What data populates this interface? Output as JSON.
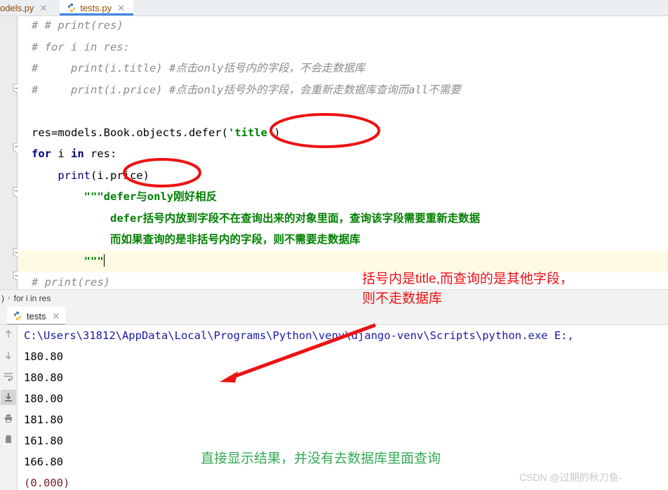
{
  "editor_tabs": [
    {
      "name": "odels.py",
      "icon": "python-file-icon",
      "active": false,
      "close": "✕"
    },
    {
      "name": "tests.py",
      "icon": "python-file-icon",
      "active": true,
      "close": "✕"
    }
  ],
  "code_lines": [
    {
      "indent": 0,
      "segments": [
        {
          "cls": "cmt",
          "text": "# # print(res)"
        }
      ]
    },
    {
      "indent": 0,
      "segments": [
        {
          "cls": "cmt",
          "text": "# for i in res:"
        }
      ]
    },
    {
      "indent": 0,
      "segments": [
        {
          "cls": "cmt",
          "text": "#     print(i.title) #点击only括号内的字段，不会走数据库"
        }
      ]
    },
    {
      "indent": 0,
      "segments": [
        {
          "cls": "cmt",
          "text": "#     print(i.price) #点击only括号外的字段，会重新走数据库查询而all不需要"
        }
      ]
    },
    {
      "indent": 0,
      "segments": [
        {
          "cls": "plain",
          "text": ""
        }
      ]
    },
    {
      "indent": 0,
      "segments": [
        {
          "cls": "plain",
          "text": "res"
        },
        {
          "cls": "plain",
          "text": "=models.Book.objects.defer("
        },
        {
          "cls": "str",
          "text": "'title'"
        },
        {
          "cls": "plain",
          "text": ")"
        }
      ]
    },
    {
      "indent": 0,
      "segments": [
        {
          "cls": "kw",
          "text": "for"
        },
        {
          "cls": "plain",
          "text": " i "
        },
        {
          "cls": "kw",
          "text": "in"
        },
        {
          "cls": "plain",
          "text": " res:"
        }
      ]
    },
    {
      "indent": 0,
      "segments": [
        {
          "cls": "fn",
          "text": "    print"
        },
        {
          "cls": "plain",
          "text": "(i.price)"
        }
      ]
    },
    {
      "indent": 0,
      "segments": [
        {
          "cls": "doc",
          "text": "        \"\"\"defer与only刚好相反"
        }
      ]
    },
    {
      "indent": 0,
      "segments": [
        {
          "cls": "doc",
          "text": "            defer括号内放到字段不在查询出来的对象里面，查询该字段需要重新走数据"
        }
      ]
    },
    {
      "indent": 0,
      "segments": [
        {
          "cls": "doc",
          "text": "            而如果查询的是非括号内的字段，则不需要走数据库"
        }
      ]
    },
    {
      "indent": 0,
      "segments": [
        {
          "cls": "doc",
          "text": "        \"\"\""
        }
      ],
      "highlight": true,
      "caret": true
    },
    {
      "indent": 0,
      "segments": [
        {
          "cls": "cmt",
          "text": "# print(res)"
        }
      ]
    }
  ],
  "breadcrumb": {
    "first": ")",
    "separator": "›",
    "last": "for i in res"
  },
  "run_tab": {
    "label": "tests",
    "icon": "python-file-icon",
    "close": "✕"
  },
  "run_sidebar_icons": [
    {
      "name": "rerun-arrow-up-icon",
      "selected": false
    },
    {
      "name": "arrow-down-icon",
      "selected": false
    },
    {
      "name": "soft-wrap-icon",
      "selected": false
    },
    {
      "name": "scroll-to-end-icon",
      "selected": true
    },
    {
      "name": "print-icon",
      "selected": false
    },
    {
      "name": "trash-icon",
      "selected": false
    }
  ],
  "console_lines": [
    {
      "cls": "c-path",
      "text": "C:\\Users\\31812\\AppData\\Local\\Programs\\Python\\venv\\django-venv\\Scripts\\python.exe E:,"
    },
    {
      "cls": "plain",
      "text": "180.80"
    },
    {
      "cls": "plain",
      "text": "180.80"
    },
    {
      "cls": "plain",
      "text": "180.00"
    },
    {
      "cls": "plain",
      "text": "181.80"
    },
    {
      "cls": "plain",
      "text": "161.80"
    },
    {
      "cls": "plain",
      "text": "166.80"
    },
    {
      "cls": "c-err",
      "text": "(0.000)"
    }
  ],
  "annotations": {
    "red_note_line1": "括号内是title,而查询的是其他字段，",
    "red_note_line2": "则不走数据库",
    "green_note": "直接显示结果，并没有去数据库里面查询",
    "ellipse_defer_title": "ellipse-around-defer-title",
    "ellipse_print_price": "ellipse-around-print-price",
    "arrow": "red-arrow-pointing-left-down"
  },
  "watermark": "CSDN @过期的秋刀鱼-",
  "colors": {
    "annotation_red": "#ee1111",
    "annotation_green": "#33aa55",
    "tab_accent": "#3f85e8",
    "string_green": "#008000",
    "keyword_navy": "#000080",
    "comment_gray": "#8c8c8c",
    "console_path_blue": "#1a1aa6",
    "highlight_yellow": "#fffae3"
  }
}
